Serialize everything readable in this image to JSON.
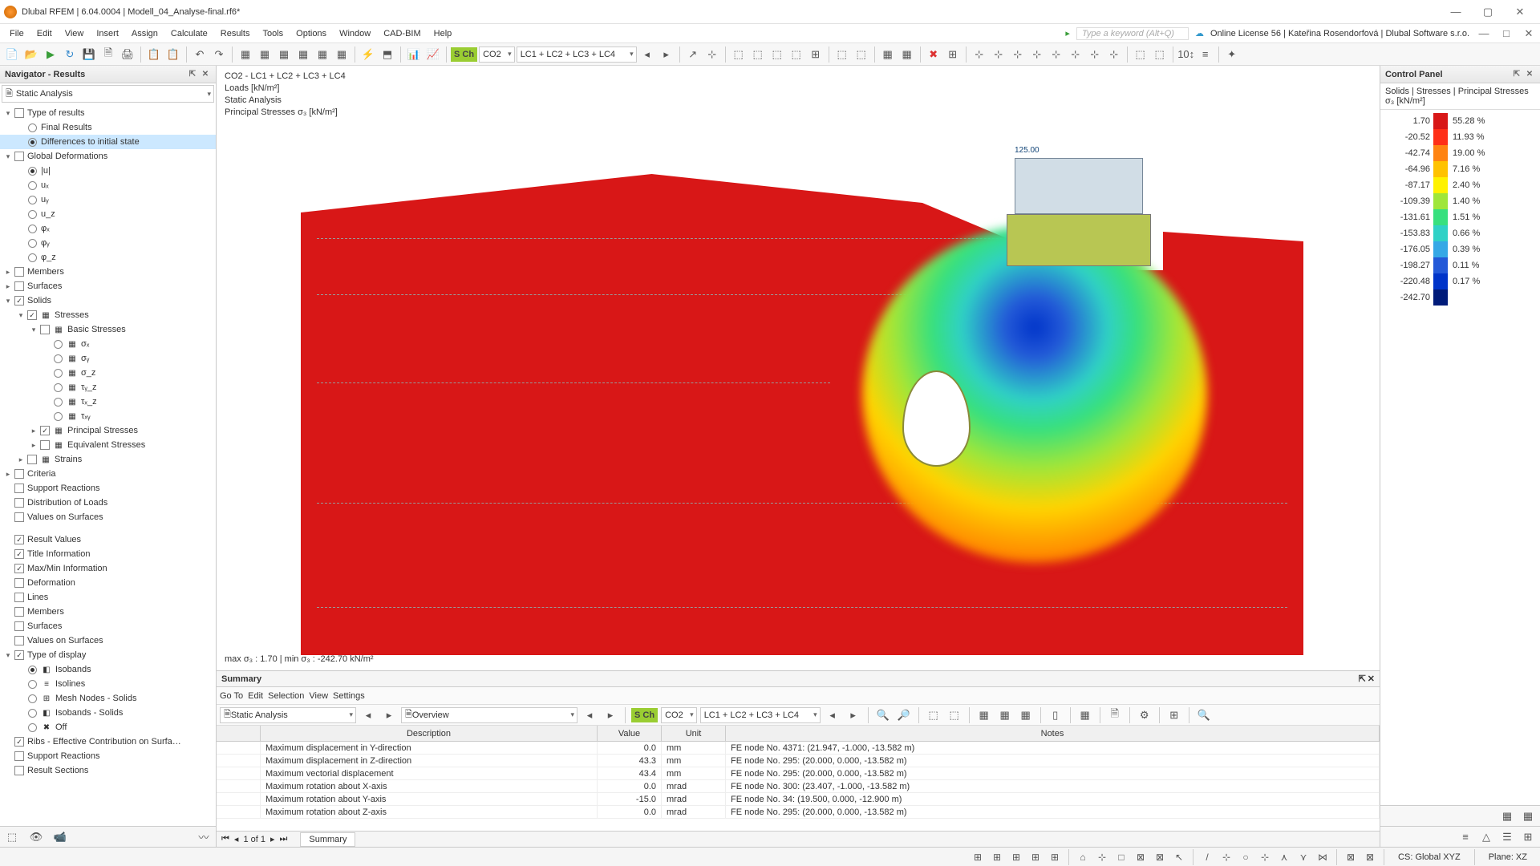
{
  "title": "Dlubal RFEM | 6.04.0004 | Modell_04_Analyse-final.rf6*",
  "menu": [
    "File",
    "Edit",
    "View",
    "Insert",
    "Assign",
    "Calculate",
    "Results",
    "Tools",
    "Options",
    "Window",
    "CAD-BIM",
    "Help"
  ],
  "keyword_ph": "Type a keyword (Alt+Q)",
  "license": "Online License 56 | Kateřina Rosendorfová | Dlubal Software s.r.o.",
  "toolbar_combo": {
    "sch": "S Ch",
    "lc": "CO2",
    "lcs": "LC1 + LC2 + LC3 + LC4"
  },
  "nav": {
    "title": "Navigator - Results",
    "combo": "Static Analysis",
    "g1": [
      {
        "t": 0,
        "tw": "▾",
        "cb": "",
        "lbl": "Type of results"
      },
      {
        "t": 1,
        "rd": false,
        "lbl": "Final Results"
      },
      {
        "t": 1,
        "rd": true,
        "lbl": "Differences to initial state",
        "sel": true
      },
      {
        "t": 0,
        "tw": "▾",
        "cb": "",
        "lbl": "Global Deformations"
      },
      {
        "t": 1,
        "rd": true,
        "lbl": "|u|"
      },
      {
        "t": 1,
        "rd": false,
        "lbl": "uₓ"
      },
      {
        "t": 1,
        "rd": false,
        "lbl": "uᵧ"
      },
      {
        "t": 1,
        "rd": false,
        "lbl": "u_z"
      },
      {
        "t": 1,
        "rd": false,
        "lbl": "φₓ"
      },
      {
        "t": 1,
        "rd": false,
        "lbl": "φᵧ"
      },
      {
        "t": 1,
        "rd": false,
        "lbl": "φ_z"
      },
      {
        "t": 0,
        "tw": "▸",
        "cb": "",
        "lbl": "Members"
      },
      {
        "t": 0,
        "tw": "▸",
        "cb": "",
        "lbl": "Surfaces"
      },
      {
        "t": 0,
        "tw": "▾",
        "cb": "✓",
        "lbl": "Solids"
      },
      {
        "t": 1,
        "tw": "▾",
        "cb": "✓",
        "ico": "▦",
        "lbl": "Stresses"
      },
      {
        "t": 2,
        "tw": "▾",
        "cb": "",
        "ico": "▦",
        "lbl": "Basic Stresses"
      },
      {
        "t": 3,
        "rd": false,
        "ico": "▦",
        "lbl": "σₓ"
      },
      {
        "t": 3,
        "rd": false,
        "ico": "▦",
        "lbl": "σᵧ"
      },
      {
        "t": 3,
        "rd": false,
        "ico": "▦",
        "lbl": "σ_z"
      },
      {
        "t": 3,
        "rd": false,
        "ico": "▦",
        "lbl": "τᵧ_z"
      },
      {
        "t": 3,
        "rd": false,
        "ico": "▦",
        "lbl": "τₓ_z"
      },
      {
        "t": 3,
        "rd": false,
        "ico": "▦",
        "lbl": "τₓᵧ"
      },
      {
        "t": 2,
        "tw": "▸",
        "cb": "✓",
        "ico": "▦",
        "lbl": "Principal Stresses"
      },
      {
        "t": 2,
        "tw": "▸",
        "cb": "",
        "ico": "▦",
        "lbl": "Equivalent Stresses"
      },
      {
        "t": 1,
        "tw": "▸",
        "cb": "",
        "ico": "▦",
        "lbl": "Strains"
      },
      {
        "t": 0,
        "tw": "▸",
        "cb": "",
        "lbl": "Criteria"
      },
      {
        "t": 0,
        "tw": "",
        "cb": "",
        "lbl": "Support Reactions"
      },
      {
        "t": 0,
        "tw": "",
        "cb": "",
        "lbl": "Distribution of Loads"
      },
      {
        "t": 0,
        "tw": "",
        "cb": "",
        "lbl": "Values on Surfaces"
      }
    ],
    "g2": [
      {
        "t": 0,
        "cb": "✓",
        "lbl": "Result Values"
      },
      {
        "t": 0,
        "cb": "✓",
        "lbl": "Title Information"
      },
      {
        "t": 0,
        "cb": "✓",
        "lbl": "Max/Min Information"
      },
      {
        "t": 0,
        "cb": "",
        "lbl": "Deformation"
      },
      {
        "t": 0,
        "cb": "",
        "lbl": "Lines"
      },
      {
        "t": 0,
        "cb": "",
        "lbl": "Members"
      },
      {
        "t": 0,
        "cb": "",
        "lbl": "Surfaces"
      },
      {
        "t": 0,
        "cb": "",
        "lbl": "Values on Surfaces"
      },
      {
        "t": 0,
        "tw": "▾",
        "cb": "✓",
        "lbl": "Type of display"
      },
      {
        "t": 1,
        "rd": true,
        "ico": "◧",
        "lbl": "Isobands"
      },
      {
        "t": 1,
        "rd": false,
        "ico": "≡",
        "lbl": "Isolines"
      },
      {
        "t": 1,
        "rd": false,
        "ico": "⊞",
        "lbl": "Mesh Nodes - Solids"
      },
      {
        "t": 1,
        "rd": false,
        "ico": "◧",
        "lbl": "Isobands - Solids"
      },
      {
        "t": 1,
        "rd": false,
        "ico": "✖",
        "lbl": "Off"
      },
      {
        "t": 0,
        "cb": "✓",
        "lbl": "Ribs - Effective Contribution on Surfa…"
      },
      {
        "t": 0,
        "cb": "",
        "lbl": "Support Reactions"
      },
      {
        "t": 0,
        "cb": "",
        "lbl": "Result Sections"
      }
    ]
  },
  "view_labels": {
    "l1": "CO2 - LC1 + LC2 + LC3 + LC4",
    "l2": "Loads [kN/m²]",
    "l3": "Static Analysis",
    "l4": "Principal Stresses σ₃ [kN/m²]",
    "bottom": "max σ₃ : 1.70 | min σ₃ : -242.70 kN/m²",
    "loadv": "125.00"
  },
  "cpanel": {
    "title": "Control Panel",
    "sub": "Solids | Stresses | Principal Stresses σ₃ [kN/m²]",
    "vals": [
      "1.70",
      "-20.52",
      "-42.74",
      "-64.96",
      "-87.17",
      "-109.39",
      "-131.61",
      "-153.83",
      "-176.05",
      "-198.27",
      "-220.48",
      "-242.70"
    ],
    "cols": [
      "#d81717",
      "#ff2f17",
      "#ff8311",
      "#ffc200",
      "#fff200",
      "#9fe63a",
      "#37e07e",
      "#2fd1c6",
      "#35a8e6",
      "#2359d8",
      "#0034c9",
      "#001b7a"
    ],
    "pcts": [
      "55.28 %",
      "11.93 %",
      "19.00 %",
      "7.16 %",
      "2.40 %",
      "1.40 %",
      "1.51 %",
      "0.66 %",
      "0.39 %",
      "0.11 %",
      "0.17 %"
    ]
  },
  "summary": {
    "title": "Summary",
    "tabs": [
      "Go To",
      "Edit",
      "Selection",
      "View",
      "Settings"
    ],
    "combo1": "Static Analysis",
    "combo2": "Overview",
    "sch": "S Ch",
    "lc": "CO2",
    "lcs": "LC1 + LC2 + LC3 + LC4",
    "headers": [
      "Description",
      "Value",
      "Unit",
      "Notes"
    ],
    "rows": [
      [
        "Maximum displacement in Y-direction",
        "0.0",
        "mm",
        "FE node No. 4371: (21.947, -1.000, -13.582 m)"
      ],
      [
        "Maximum displacement in Z-direction",
        "43.3",
        "mm",
        "FE node No. 295: (20.000, 0.000, -13.582 m)"
      ],
      [
        "Maximum vectorial displacement",
        "43.4",
        "mm",
        "FE node No. 295: (20.000, 0.000, -13.582 m)"
      ],
      [
        "Maximum rotation about X-axis",
        "0.0",
        "mrad",
        "FE node No. 300: (23.407, -1.000, -13.582 m)"
      ],
      [
        "Maximum rotation about Y-axis",
        "-15.0",
        "mrad",
        "FE node No. 34: (19.500, 0.000, -12.900 m)"
      ],
      [
        "Maximum rotation about Z-axis",
        "0.0",
        "mrad",
        "FE node No. 295: (20.000, 0.000, -13.582 m)"
      ]
    ],
    "nav": "1 of 1",
    "tab": "Summary"
  },
  "status": {
    "cs": "CS: Global XYZ",
    "plane": "Plane: XZ"
  }
}
